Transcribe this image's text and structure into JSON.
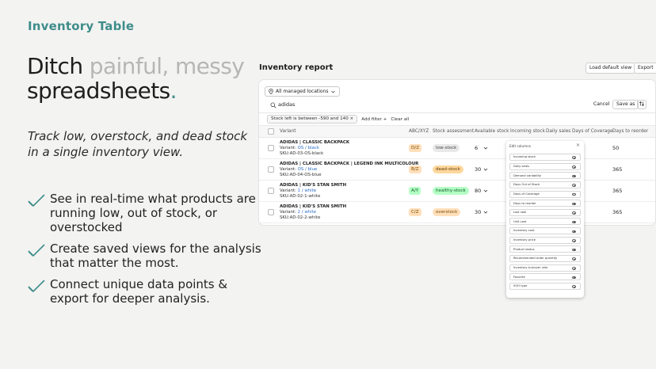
{
  "eyebrow": "Inventory Table",
  "headline": {
    "part1": "Ditch ",
    "part2_muted": "painful, messy",
    "part3": "spreadsheets",
    "dot": "."
  },
  "subhead": "Track low, overstock, and dead stock in a single inventory view.",
  "bullets": [
    "See in real-time what products are running low, out of stock, or overstocked",
    "Create saved views for the analysis that matter the most.",
    "Connect unique data points & export for deeper analysis."
  ],
  "report": {
    "title": "Inventory report",
    "load_default_label": "Load default view",
    "export_label": "Export",
    "location_label": "All managed locations",
    "search_value": "adidas",
    "cancel_label": "Cancel",
    "save_as_label": "Save as",
    "filter_chip": "Stock left is between -590 and 140",
    "filter_remove": "×",
    "add_filter_label": "Add filter +",
    "clear_all_label": "Clear all",
    "columns": [
      "Variant",
      "ABC/XYZ",
      "Stock assessment",
      "Available stock",
      "Incoming stock",
      "Daily sales",
      "Days of Coverage",
      "Days to reorder"
    ],
    "rows": [
      {
        "name": "ADIDAS | CLASSIC BACKPACK",
        "variant_prefix": "Variant: ",
        "variant_value": "OS / black",
        "sku": "SKU:AD-03-OS-black",
        "abc": "D/Z",
        "stock": "low-stock",
        "stock_kind": "low",
        "available": "6",
        "days_coverage": "50"
      },
      {
        "name": "ADIDAS | CLASSIC BACKPACK | LEGEND INK MULTICOLOUR",
        "variant_prefix": "Variant: ",
        "variant_value": "OS / blue",
        "sku": "SKU:AD-04-OS-blue",
        "abc": "B/Z",
        "stock": "dead-stock",
        "stock_kind": "dead",
        "available": "30",
        "days_coverage": "365"
      },
      {
        "name": "ADIDAS | KID'S STAN SMITH",
        "variant_prefix": "Variant: ",
        "variant_value": "1 / white",
        "sku": "SKU:AD-02-1-white",
        "abc": "A/Y",
        "stock": "healthy-stock",
        "stock_kind": "healthy",
        "available": "80",
        "days_coverage": "365"
      },
      {
        "name": "ADIDAS | KID'S STAN SMITH",
        "variant_prefix": "Variant: ",
        "variant_value": "2 / white",
        "sku": "SKU:AD-02-2-white",
        "abc": "C/Z",
        "stock": "overstock",
        "stock_kind": "over",
        "available": "30",
        "days_coverage": "365"
      }
    ],
    "edit_columns": {
      "title": "Edit columns",
      "close": "×",
      "items": [
        "Incoming stock",
        "Daily sales",
        "Demand variability",
        "Days Out of Stock",
        "Days of Coverage",
        "Days to reorder",
        "Last sale",
        "Unit cost",
        "Inventory cost",
        "Inventory price",
        "Product status",
        "Recommended order quantity",
        "Inventory turnover rate",
        "Favorite",
        "SOH type"
      ]
    }
  },
  "colors": {
    "accent": "#3f8d8a",
    "muted_text": "#b6b6b6",
    "link": "#2c6ecb",
    "low_stock_bg": "#e9e9e9",
    "dead_stock_bg": "#ffd79d",
    "healthy_stock_bg": "#b4fec5",
    "overstock_bg": "#ffdfba"
  }
}
